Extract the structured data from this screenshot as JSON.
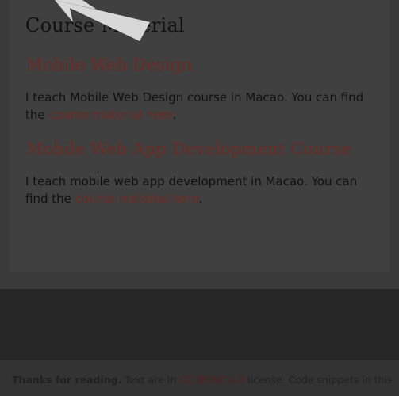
{
  "main": {
    "section_title": "Course Material",
    "courses": [
      {
        "heading": "Mobile Web Design",
        "desc_before": "I teach Mobile Web Design course in Macao. You can find the ",
        "link": "course material here",
        "desc_after": "."
      },
      {
        "heading": "Mobile Web App Development Course",
        "desc_before": "I teach mobile web app development in Macao. You can find the ",
        "link": "course material here",
        "desc_after": "."
      }
    ]
  },
  "footer": {
    "thanks": "Thanks for reading.",
    "text_before_license": " Text are in ",
    "license": "CC BY-NC 4.0",
    "text_after_license": " license. Code snippets in this site"
  },
  "colors": {
    "overlay": "#3a3a3a",
    "link": "#6b2a22",
    "footer_dark": "#262626"
  },
  "icons": {
    "pointer": "arrow-up-left-icon"
  }
}
